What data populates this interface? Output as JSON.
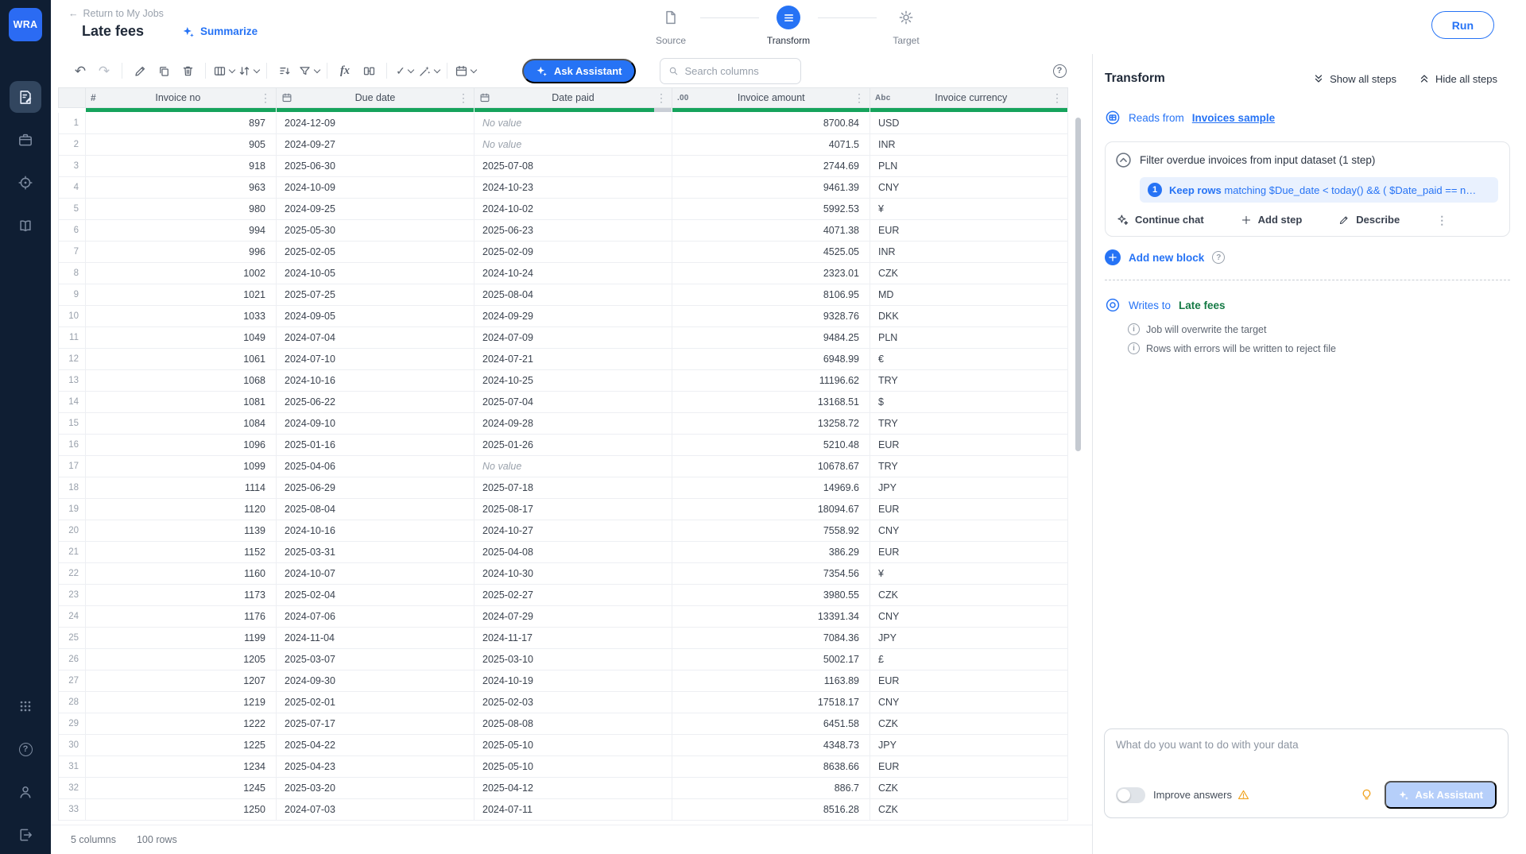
{
  "sidebar": {
    "logo_text": "WRA"
  },
  "header": {
    "back_label": "Return to My Jobs",
    "title": "Late fees",
    "summarize_label": "Summarize",
    "run_label": "Run",
    "stepper": [
      {
        "label": "Source"
      },
      {
        "label": "Transform"
      },
      {
        "label": "Target"
      }
    ]
  },
  "toolbar": {
    "ask_assistant_label": "Ask Assistant",
    "search_placeholder": "Search columns"
  },
  "table": {
    "no_value_label": "No value",
    "columns": [
      {
        "name": "Invoice no",
        "type": "number",
        "align": "right",
        "quality_green_pct": 100
      },
      {
        "name": "Due date",
        "type": "date",
        "align": "left",
        "quality_green_pct": 100
      },
      {
        "name": "Date paid",
        "type": "date",
        "align": "left",
        "quality_green_pct": 91
      },
      {
        "name": "Invoice amount",
        "type": "decimal",
        "align": "right",
        "quality_green_pct": 100
      },
      {
        "name": "Invoice currency",
        "type": "text",
        "align": "left",
        "quality_green_pct": 100
      }
    ],
    "rows": [
      [
        897,
        "2024-12-09",
        null,
        "8700.84",
        "USD"
      ],
      [
        905,
        "2024-09-27",
        null,
        "4071.5",
        "INR"
      ],
      [
        918,
        "2025-06-30",
        "2025-07-08",
        "2744.69",
        "PLN"
      ],
      [
        963,
        "2024-10-09",
        "2024-10-23",
        "9461.39",
        "CNY"
      ],
      [
        980,
        "2024-09-25",
        "2024-10-02",
        "5992.53",
        "¥"
      ],
      [
        994,
        "2025-05-30",
        "2025-06-23",
        "4071.38",
        "EUR"
      ],
      [
        996,
        "2025-02-05",
        "2025-02-09",
        "4525.05",
        "INR"
      ],
      [
        1002,
        "2024-10-05",
        "2024-10-24",
        "2323.01",
        "CZK"
      ],
      [
        1021,
        "2025-07-25",
        "2025-08-04",
        "8106.95",
        "MD"
      ],
      [
        1033,
        "2024-09-05",
        "2024-09-29",
        "9328.76",
        "DKK"
      ],
      [
        1049,
        "2024-07-04",
        "2024-07-09",
        "9484.25",
        "PLN"
      ],
      [
        1061,
        "2024-07-10",
        "2024-07-21",
        "6948.99",
        "€"
      ],
      [
        1068,
        "2024-10-16",
        "2024-10-25",
        "11196.62",
        "TRY"
      ],
      [
        1081,
        "2025-06-22",
        "2025-07-04",
        "13168.51",
        "$"
      ],
      [
        1084,
        "2024-09-10",
        "2024-09-28",
        "13258.72",
        "TRY"
      ],
      [
        1096,
        "2025-01-16",
        "2025-01-26",
        "5210.48",
        "EUR"
      ],
      [
        1099,
        "2025-04-06",
        null,
        "10678.67",
        "TRY"
      ],
      [
        1114,
        "2025-06-29",
        "2025-07-18",
        "14969.6",
        "JPY"
      ],
      [
        1120,
        "2025-08-04",
        "2025-08-17",
        "18094.67",
        "EUR"
      ],
      [
        1139,
        "2024-10-16",
        "2024-10-27",
        "7558.92",
        "CNY"
      ],
      [
        1152,
        "2025-03-31",
        "2025-04-08",
        "386.29",
        "EUR"
      ],
      [
        1160,
        "2024-10-07",
        "2024-10-30",
        "7354.56",
        "¥"
      ],
      [
        1173,
        "2025-02-04",
        "2025-02-27",
        "3980.55",
        "CZK"
      ],
      [
        1176,
        "2024-07-06",
        "2024-07-29",
        "13391.34",
        "CNY"
      ],
      [
        1199,
        "2024-11-04",
        "2024-11-17",
        "7084.36",
        "JPY"
      ],
      [
        1205,
        "2025-03-07",
        "2025-03-10",
        "5002.17",
        "£"
      ],
      [
        1207,
        "2024-09-30",
        "2024-10-19",
        "1163.89",
        "EUR"
      ],
      [
        1219,
        "2025-02-01",
        "2025-02-03",
        "17518.17",
        "CNY"
      ],
      [
        1222,
        "2025-07-17",
        "2025-08-08",
        "6451.58",
        "CZK"
      ],
      [
        1225,
        "2025-04-22",
        "2025-05-10",
        "4348.73",
        "JPY"
      ],
      [
        1234,
        "2025-04-23",
        "2025-05-10",
        "8638.66",
        "EUR"
      ],
      [
        1245,
        "2025-03-20",
        "2025-04-12",
        "886.7",
        "CZK"
      ],
      [
        1250,
        "2024-07-03",
        "2024-07-11",
        "8516.28",
        "CZK"
      ]
    ]
  },
  "status_bar": {
    "columns_label": "5 columns",
    "rows_label": "100 rows"
  },
  "panel": {
    "title": "Transform",
    "show_all_label": "Show all steps",
    "hide_all_label": "Hide all steps",
    "reads_from_label": "Reads from",
    "reads_from_link": "Invoices sample",
    "block_title": "Filter overdue invoices from input dataset (1 step)",
    "step": {
      "number": "1",
      "bold": "Keep rows",
      "rest": " matching $Due_date < today() && ( $Date_paid == n…"
    },
    "continue_chat_label": "Continue chat",
    "add_step_label": "Add step",
    "describe_label": "Describe",
    "add_new_block_label": "Add new block",
    "writes_to_label": "Writes to",
    "writes_to_target": "Late fees",
    "notes": [
      "Job will overwrite the target",
      "Rows with errors will be written to reject file"
    ],
    "composer": {
      "placeholder": "What do you want to do with your data",
      "improve_answers_label": "Improve answers",
      "ask_assistant_label": "Ask Assistant"
    }
  },
  "icons": {
    "back_arrow": "←",
    "undo": "↶",
    "redo": "↷",
    "check": "✓",
    "fx": "fx",
    "kebab": "⋮",
    "hash": "#",
    "decimal": ".00",
    "abc": "Abc",
    "question": "?",
    "info": "i",
    "plus": "+"
  }
}
